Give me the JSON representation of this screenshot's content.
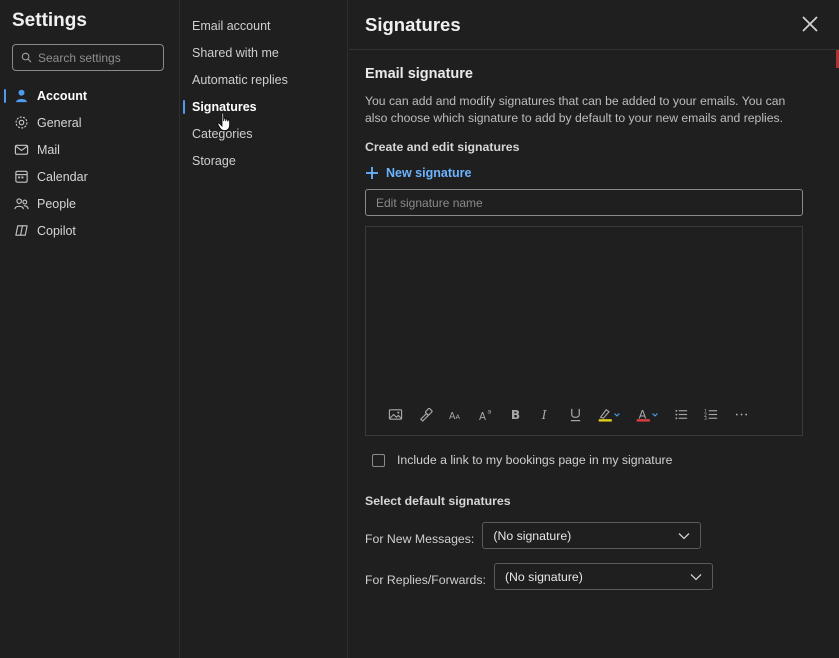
{
  "app": {
    "title": "Settings",
    "search_placeholder": "Search settings"
  },
  "nav": {
    "items": [
      {
        "label": "Account",
        "icon": "person-icon",
        "active": true
      },
      {
        "label": "General",
        "icon": "gear-icon",
        "active": false
      },
      {
        "label": "Mail",
        "icon": "mail-icon",
        "active": false
      },
      {
        "label": "Calendar",
        "icon": "calendar-icon",
        "active": false
      },
      {
        "label": "People",
        "icon": "people-icon",
        "active": false
      },
      {
        "label": "Copilot",
        "icon": "copilot-icon",
        "active": false
      }
    ]
  },
  "subnav": {
    "items": [
      {
        "label": "Email account",
        "active": false
      },
      {
        "label": "Shared with me",
        "active": false
      },
      {
        "label": "Automatic replies",
        "active": false
      },
      {
        "label": "Signatures",
        "active": true
      },
      {
        "label": "Categories",
        "active": false
      },
      {
        "label": "Storage",
        "active": false
      }
    ]
  },
  "panel": {
    "title": "Signatures",
    "section_title": "Email signature",
    "description": "You can add and modify signatures that can be added to your emails. You can also choose which signature to add by default to your new emails and replies.",
    "create_title": "Create and edit signatures",
    "new_signature_label": "New signature",
    "name_placeholder": "Edit signature name",
    "bookings_label": "Include a link to my bookings page in my signature",
    "defaults_title": "Select default signatures",
    "new_messages_label": "For New Messages:",
    "new_messages_value": "(No signature)",
    "replies_label": "For Replies/Forwards:",
    "replies_value": "(No signature)"
  },
  "colors": {
    "accent": "#4f9bf0",
    "link": "#6cb3ff",
    "highlight": "#e3d21c",
    "font_color": "#e04040"
  }
}
